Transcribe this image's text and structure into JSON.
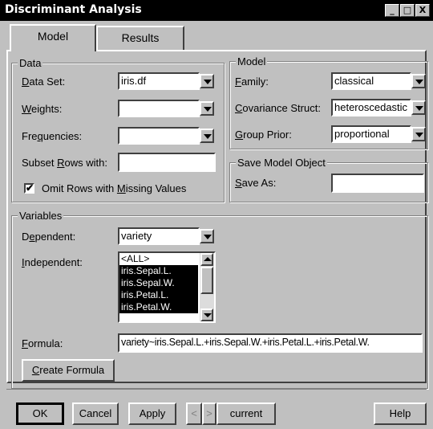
{
  "window": {
    "title": "Discriminant Analysis",
    "controls": {
      "minimize": "_",
      "maximize": "□",
      "close": "X"
    }
  },
  "tabs": [
    {
      "label": "Model"
    },
    {
      "label": "Results"
    }
  ],
  "data_group": {
    "legend": "Data",
    "data_set": {
      "label_prefix": "",
      "label_ul": "D",
      "label_rest": "ata Set:",
      "value": "iris.df"
    },
    "weights": {
      "label_ul": "W",
      "label_rest": "eights:",
      "value": ""
    },
    "frequencies": {
      "label_pre": "Fre",
      "label_ul": "q",
      "label_rest": "uencies:",
      "value": ""
    },
    "subset": {
      "label_pre": "Subset ",
      "label_ul": "R",
      "label_rest": "ows with:",
      "value": ""
    },
    "omit": {
      "label_pre": "Omit Rows with ",
      "label_ul": "M",
      "label_rest": "issing Values",
      "checked": true,
      "mark": "✔"
    }
  },
  "model_group": {
    "legend": "Model",
    "family": {
      "label_ul": "F",
      "label_rest": "amily:",
      "value": "classical"
    },
    "covariance": {
      "label_ul": "C",
      "label_rest": "ovariance Struct:",
      "value": "heteroscedastic"
    },
    "prior": {
      "label_ul": "G",
      "label_rest": "roup Prior:",
      "value": "proportional"
    }
  },
  "save_group": {
    "legend": "Save Model Object",
    "save_as": {
      "label_ul": "S",
      "label_rest": "ave As:",
      "value": ""
    }
  },
  "variables_group": {
    "legend": "Variables",
    "dependent": {
      "label_pre": "D",
      "label_ul": "e",
      "label_rest": "pendent:",
      "value": "variety"
    },
    "independent": {
      "label_ul": "I",
      "label_rest": "ndependent:",
      "items": [
        "<ALL>",
        "iris.Sepal.L.",
        "iris.Sepal.W.",
        "iris.Petal.L.",
        "iris.Petal.W.",
        "..."
      ]
    },
    "formula": {
      "label_ul": "F",
      "label_rest": "ormula:",
      "value": "variety~iris.Sepal.L.+iris.Sepal.W.+iris.Petal.L.+iris.Petal.W."
    },
    "create_formula": {
      "label_ul": "C",
      "label_rest": "reate Formula"
    }
  },
  "footer": {
    "ok": "OK",
    "cancel": "Cancel",
    "apply": "Apply",
    "prev": "<",
    "next": ">",
    "current": "current",
    "help": "Help"
  }
}
